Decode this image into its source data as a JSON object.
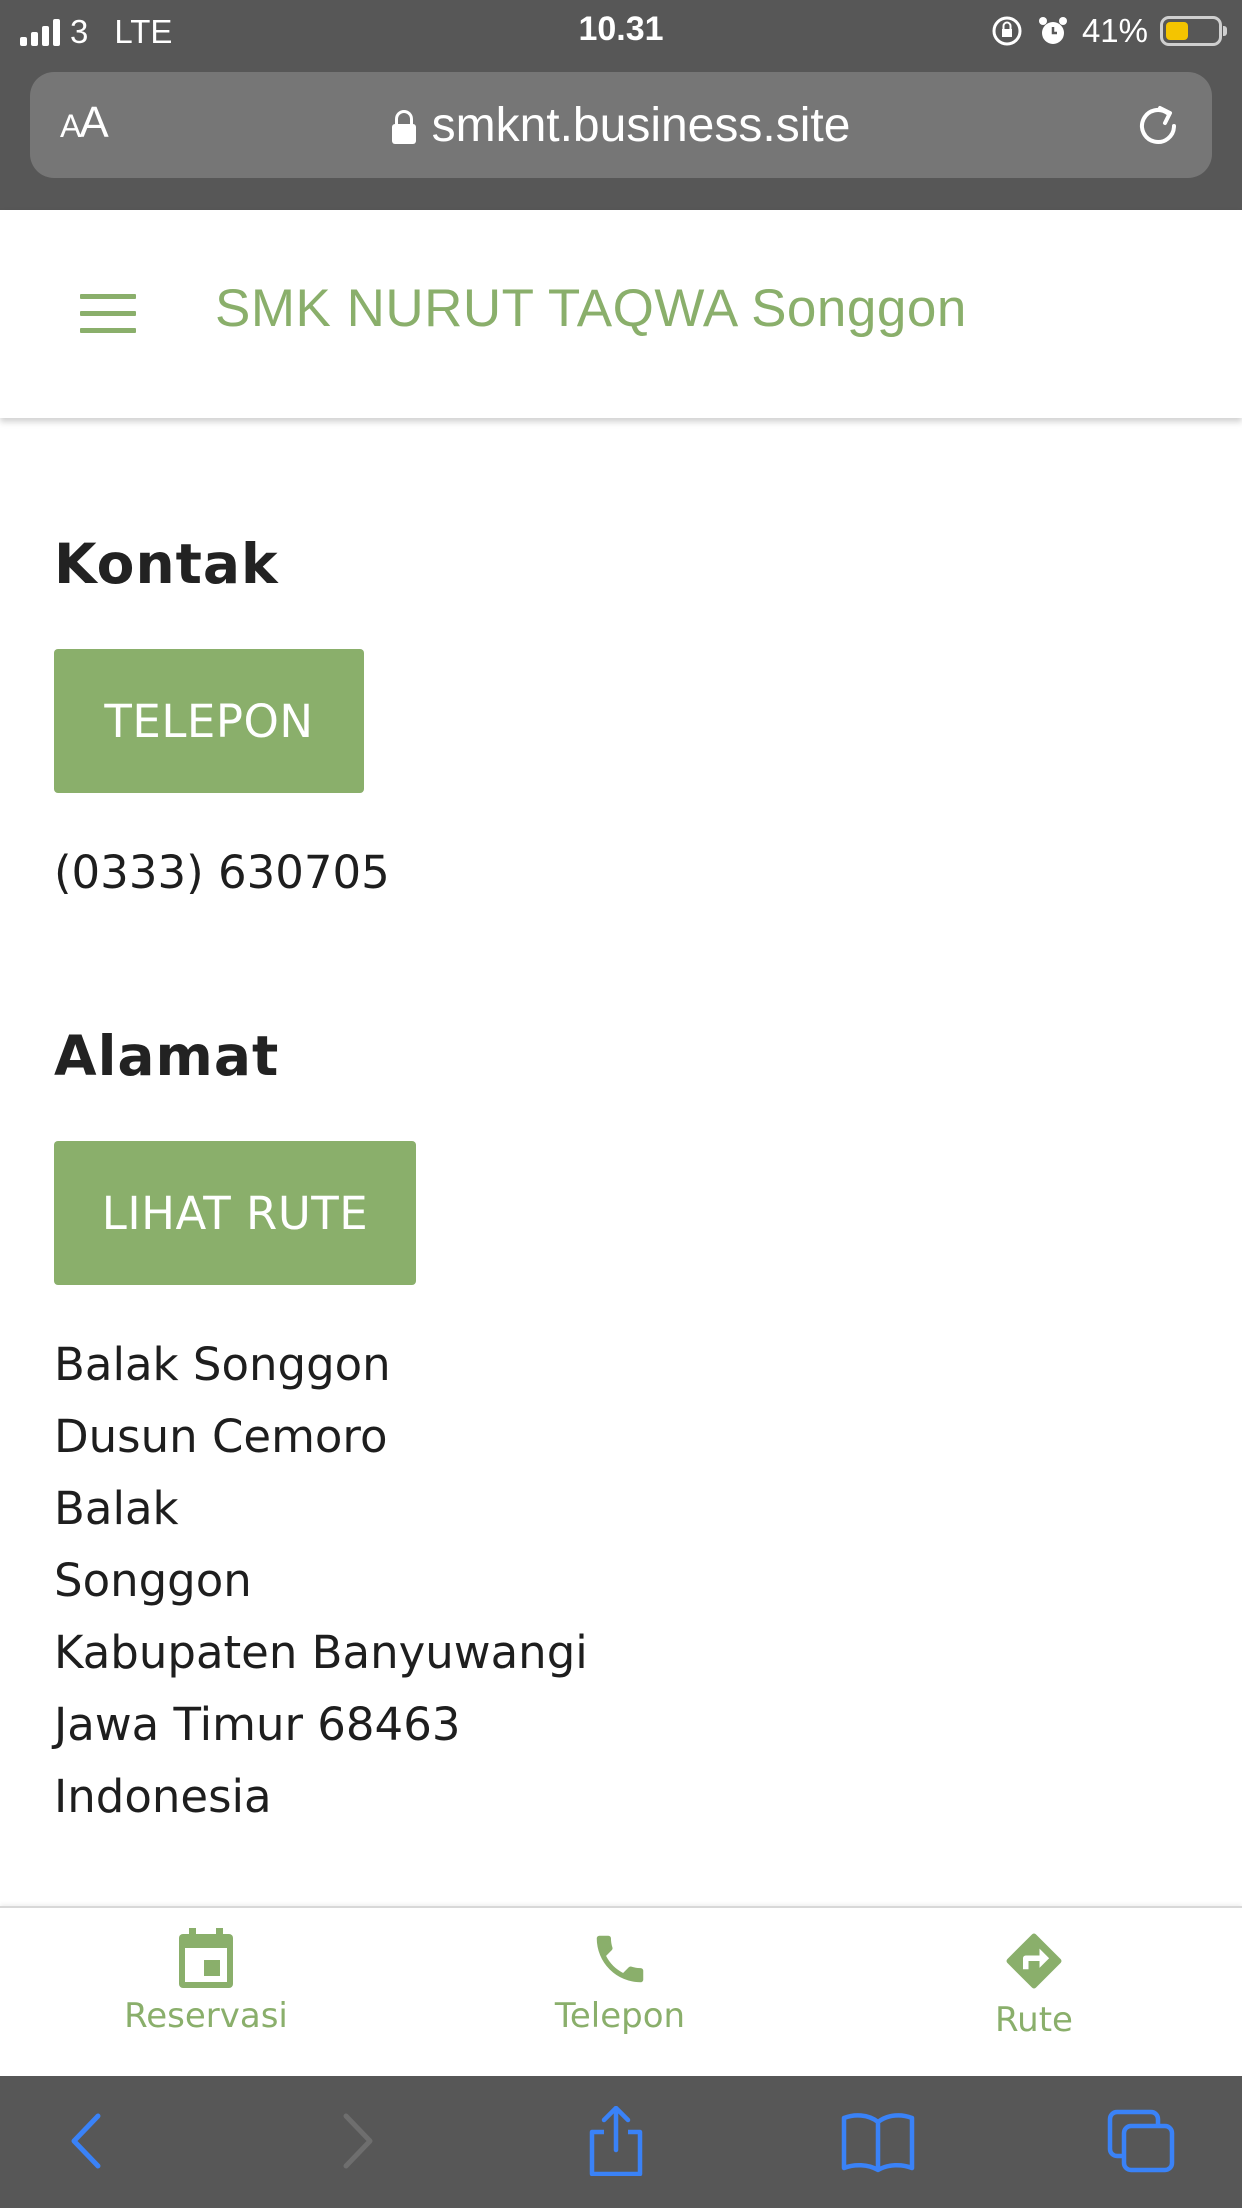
{
  "status_bar": {
    "carrier": "3",
    "network": "LTE",
    "time": "10.31",
    "battery_percent": "41%",
    "battery_level": 0.41
  },
  "browser": {
    "text_size_label": "AA",
    "url": "smknt.business.site"
  },
  "site": {
    "title": "SMK NURUT TAQWA Songgon",
    "accent_color": "#8aaf6b"
  },
  "contact": {
    "heading": "Kontak",
    "call_button": "TELEPON",
    "phone": "(0333) 630705"
  },
  "address": {
    "heading": "Alamat",
    "route_button": "LIHAT RUTE",
    "lines": [
      "Balak Songgon",
      "Dusun Cemoro",
      "Balak",
      "Songgon",
      "Kabupaten Banyuwangi",
      "Jawa Timur 68463",
      "Indonesia"
    ]
  },
  "action_bar": {
    "items": [
      {
        "label": "Reservasi",
        "icon": "calendar-icon"
      },
      {
        "label": "Telepon",
        "icon": "phone-icon"
      },
      {
        "label": "Rute",
        "icon": "directions-icon"
      }
    ]
  },
  "toolbar": {
    "icons": [
      "back-icon",
      "forward-icon",
      "share-icon",
      "bookmarks-icon",
      "tabs-icon"
    ],
    "icon_color": "#3a82f7"
  }
}
